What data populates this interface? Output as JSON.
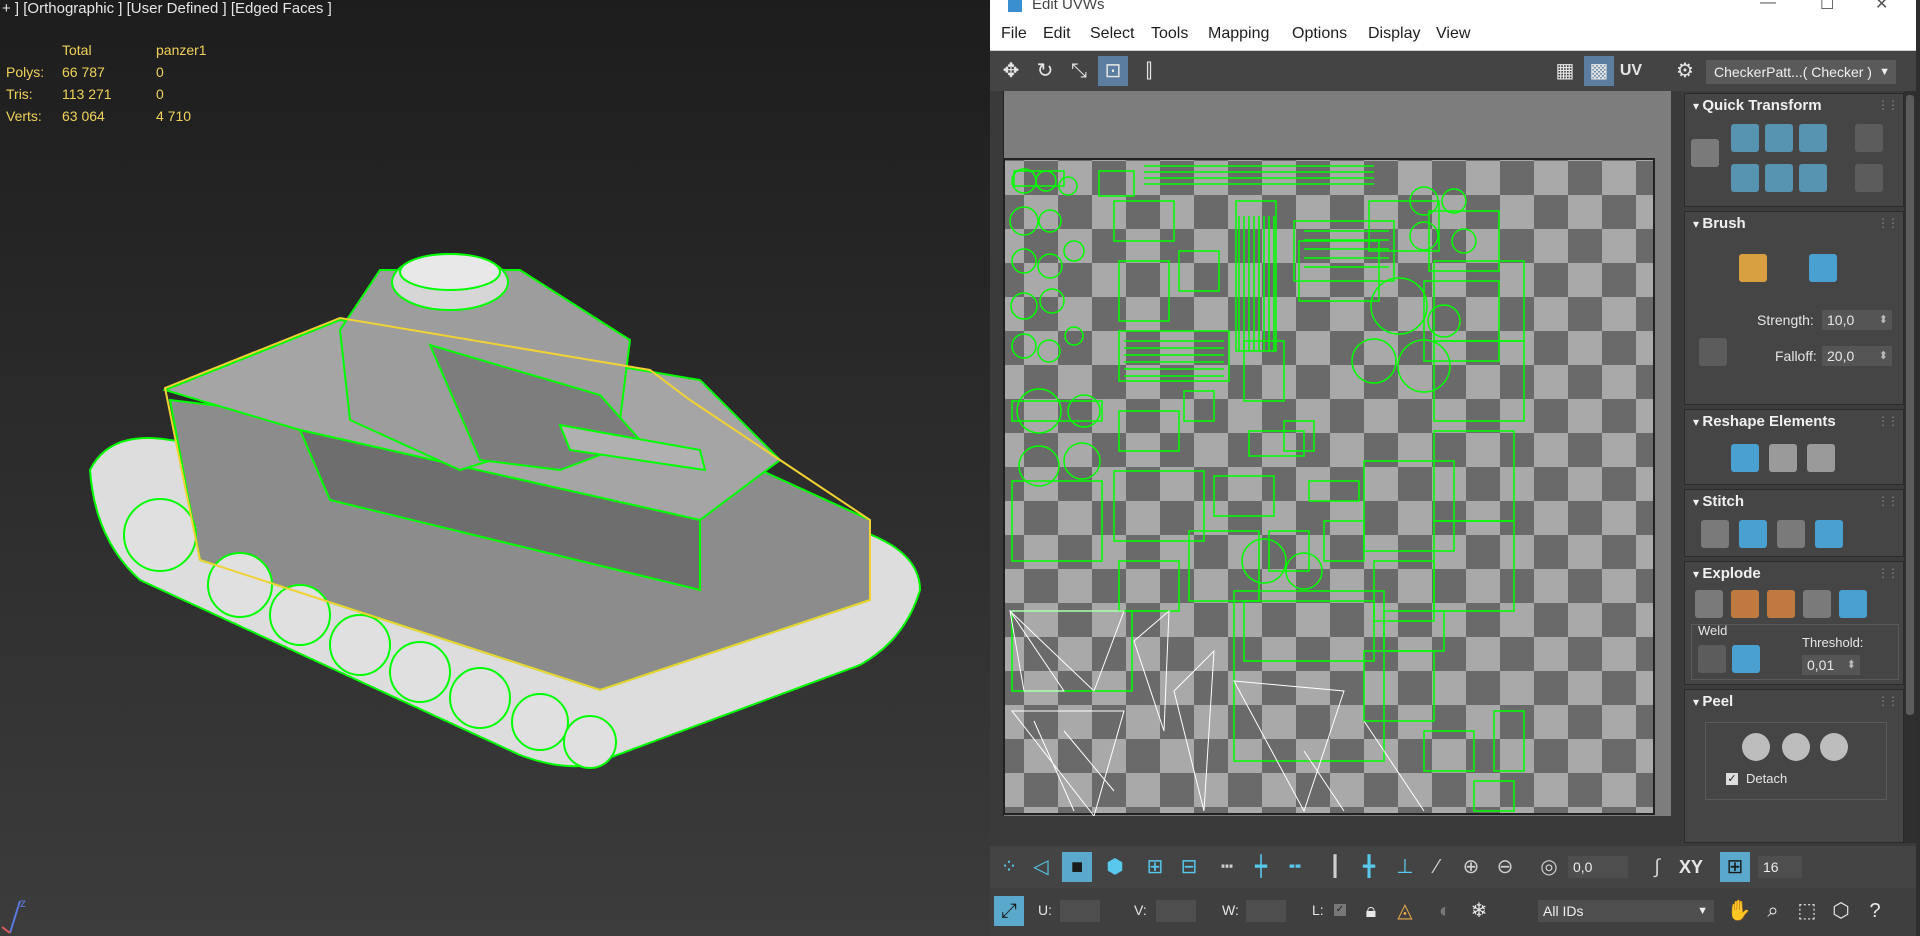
{
  "viewport": {
    "label": "+ ] [Orthographic ] [User Defined ] [Edged Faces ]",
    "stats": {
      "headers": [
        "",
        "Total",
        "panzer1"
      ],
      "rows": [
        {
          "label": "Polys:",
          "total": "66 787",
          "object": "0"
        },
        {
          "label": "Tris:",
          "total": "113 271",
          "object": "0"
        },
        {
          "label": "Verts:",
          "total": "63 064",
          "object": "4 710"
        }
      ]
    },
    "axis_label": "z"
  },
  "uv_editor": {
    "title": "Edit UVWs",
    "window_controls": [
      "—",
      "☐",
      "✕"
    ],
    "menu": [
      "File",
      "Edit",
      "Select",
      "Tools",
      "Mapping",
      "Options",
      "Display",
      "View"
    ],
    "uv_label": "UV",
    "texture_dropdown": "CheckerPatt...( Checker )",
    "colors": {
      "uv_wire": "#00ff00",
      "selected_edge": "#ffffff",
      "accent": "#58c8ec"
    },
    "rollouts": {
      "quick_transform": {
        "title": "Quick Transform"
      },
      "brush": {
        "title": "Brush",
        "strength_label": "Strength:",
        "strength_value": "10,0",
        "falloff_label": "Falloff:",
        "falloff_value": "20,0"
      },
      "reshape": {
        "title": "Reshape Elements"
      },
      "stitch": {
        "title": "Stitch"
      },
      "explode": {
        "title": "Explode",
        "weld_label": "Weld",
        "threshold_label": "Threshold:",
        "threshold_value": "0,01"
      },
      "peel": {
        "title": "Peel",
        "detach_label": "Detach"
      }
    },
    "bottom": {
      "angle_value": "0,0",
      "xy_label": "XY",
      "grid_value": "16",
      "u_label": "U:",
      "v_label": "V:",
      "w_label": "W:",
      "l_label": "L:",
      "ids_dropdown": "All IDs"
    }
  }
}
